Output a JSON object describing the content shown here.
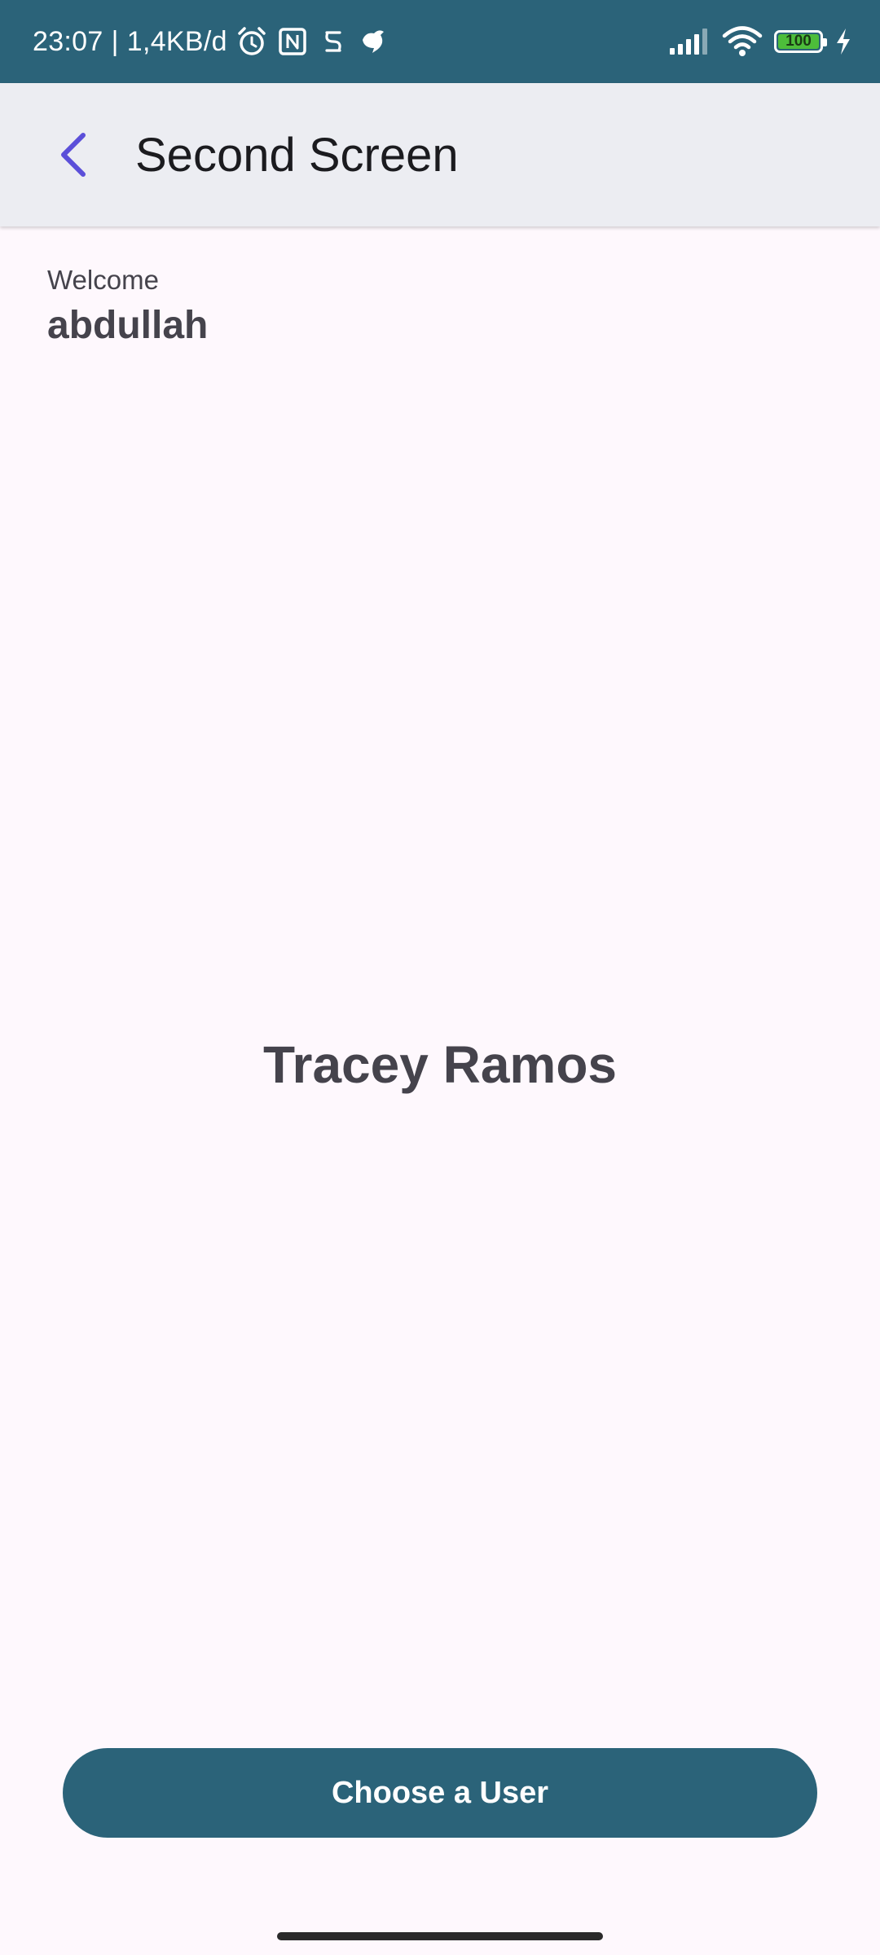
{
  "status_bar": {
    "time": "23:07",
    "separator": "|",
    "net_speed": "1,4KB/d",
    "icons": [
      "alarm-icon",
      "nfc-icon",
      "app-notification-icon",
      "bird-notification-icon",
      "signal-icon",
      "wifi-icon",
      "battery-icon",
      "charging-icon"
    ],
    "battery_level": "100",
    "battery_color": "#4DBD3A",
    "background_color": "#2B6379"
  },
  "app_bar": {
    "back_icon": "back-arrow-icon",
    "back_icon_color": "#5B4FD9",
    "title": "Second Screen"
  },
  "greeting": {
    "label": "Welcome",
    "name": "abdullah"
  },
  "selected_user": {
    "name": "Tracey Ramos"
  },
  "actions": {
    "choose_user_label": "Choose a User",
    "button_color": "#2B6379"
  }
}
